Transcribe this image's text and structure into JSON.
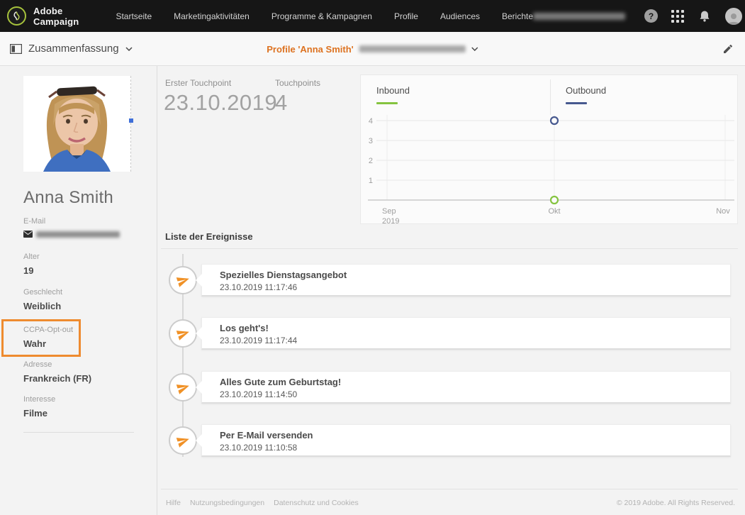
{
  "nav": {
    "brand": "Adobe Campaign",
    "items": [
      "Startseite",
      "Marketingaktivitäten",
      "Programme & Kampagnen",
      "Profile",
      "Audiences",
      "Berichte"
    ],
    "help_glyph": "?"
  },
  "toolbar": {
    "view_label": "Zusammenfassung",
    "title": "Profile 'Anna Smith'"
  },
  "profile": {
    "name": "Anna Smith",
    "fields": [
      {
        "label": "E-Mail",
        "value": ""
      },
      {
        "label": "Alter",
        "value": "19"
      },
      {
        "label": "Geschlecht",
        "value": "Weiblich"
      },
      {
        "label": "CCPA-Opt-out",
        "value": "Wahr"
      },
      {
        "label": "Adresse",
        "value": "Frankreich (FR)"
      },
      {
        "label": "Interesse",
        "value": "Filme"
      }
    ]
  },
  "stats": {
    "first_touchpoint_label": "Erster Touchpoint",
    "first_touchpoint_value": "23.10.2019",
    "touchpoints_label": "Touchpoints",
    "touchpoints_value": "4"
  },
  "chart_data": {
    "type": "scatter",
    "title": "",
    "series": [
      {
        "name": "Inbound",
        "color": "#85c440",
        "points": [
          {
            "x": "Okt",
            "y": 0
          }
        ]
      },
      {
        "name": "Outbound",
        "color": "#47598f",
        "points": [
          {
            "x": "Okt",
            "y": 4
          }
        ]
      }
    ],
    "yticks": [
      "4",
      "3",
      "2",
      "1"
    ],
    "xticks": [
      "Sep",
      "Okt",
      "Nov"
    ],
    "x_sub_label": "2019",
    "ylim": [
      0,
      4
    ],
    "grid": true,
    "legend_position": "top"
  },
  "events": {
    "title": "Liste der Ereignisse",
    "items": [
      {
        "title": "Spezielles Dienstagsangebot",
        "time": "23.10.2019 11:17:46"
      },
      {
        "title": "Los geht's!",
        "time": "23.10.2019 11:17:44"
      },
      {
        "title": "Alles Gute zum Geburtstag!",
        "time": "23.10.2019 11:14:50"
      },
      {
        "title": "Per E-Mail versenden",
        "time": "23.10.2019 11:10:58"
      }
    ]
  },
  "footer": {
    "links": [
      "Hilfe",
      "Nutzungsbedingungen",
      "Datenschutz und Cookies"
    ],
    "copyright": "© 2019 Adobe. All Rights Reserved."
  },
  "colors": {
    "accent_orange": "#ee8b2f",
    "inbound_green": "#85c440",
    "outbound_blue": "#47598f"
  }
}
